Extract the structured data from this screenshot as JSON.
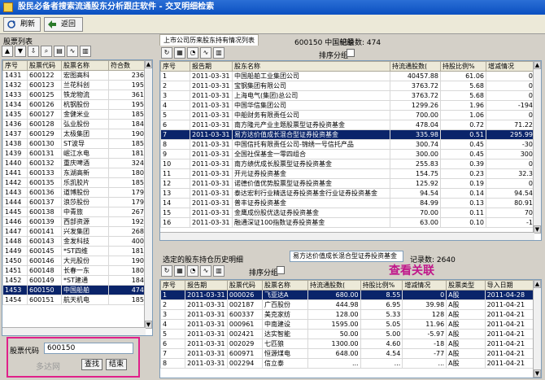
{
  "window": {
    "title": "股民必备者搜索流通股东分析跟庄软件 - 交叉明细检索"
  },
  "toolbar": {
    "refresh_label": "刷新",
    "back_label": "返回"
  },
  "left": {
    "panel_title": "股票列表",
    "columns": [
      "序号",
      "股票代码",
      "股票名称",
      "符合数"
    ],
    "rows": [
      [
        "1431",
        "600122",
        "宏图高科",
        "236"
      ],
      [
        "1432",
        "600123",
        "兰花科创",
        "195"
      ],
      [
        "1433",
        "600125",
        "铁龙物流",
        "361"
      ],
      [
        "1434",
        "600126",
        "杭钢股份",
        "195"
      ],
      [
        "1435",
        "600127",
        "金健米业",
        "185"
      ],
      [
        "1436",
        "600128",
        "弘业股份",
        "184"
      ],
      [
        "1437",
        "600129",
        "太极集团",
        "190"
      ],
      [
        "1438",
        "600130",
        "ST波导",
        "185"
      ],
      [
        "1439",
        "600131",
        "岷江水电",
        "181"
      ],
      [
        "1440",
        "600132",
        "重庆啤酒",
        "324"
      ],
      [
        "1441",
        "600133",
        "东湖高新",
        "180"
      ],
      [
        "1442",
        "600135",
        "乐凯胶片",
        "185"
      ],
      [
        "1443",
        "600136",
        "道博股份",
        "179"
      ],
      [
        "1444",
        "600137",
        "浪莎股份",
        "179"
      ],
      [
        "1445",
        "600138",
        "中青旅",
        "267"
      ],
      [
        "1446",
        "600139",
        "西部资源",
        "192"
      ],
      [
        "1447",
        "600141",
        "兴发集团",
        "268"
      ],
      [
        "1448",
        "600143",
        "金发科技",
        "400"
      ],
      [
        "1449",
        "600145",
        "*ST四维",
        "181"
      ],
      [
        "1450",
        "600146",
        "大元股份",
        "190"
      ],
      [
        "1451",
        "600148",
        "长春一东",
        "180"
      ],
      [
        "1452",
        "600149",
        "*ST建通",
        "184"
      ],
      [
        "1453",
        "600150",
        "中国船舶",
        "474"
      ],
      [
        "1454",
        "600151",
        "航天机电",
        "185"
      ]
    ],
    "selected_index": 22,
    "search": {
      "label": "股票代码",
      "value": "600150",
      "find_label": "查找",
      "close_label": "结束"
    }
  },
  "top": {
    "tab_label": "上市公司历来股东持有情况列表",
    "stock_info": "600150 中国船舶",
    "record_label": "记录数: 474",
    "sort_label": "排序分组",
    "columns": [
      "序号",
      "报告期",
      "股东名称",
      "持流通股数(",
      "持股比例%",
      "增减情况"
    ],
    "rows": [
      [
        "1",
        "2011-03-31",
        "中国船舶工业集团公司",
        "40457.88",
        "61.06",
        "0"
      ],
      [
        "2",
        "2011-03-31",
        "宝钢集团有限公司",
        "3763.72",
        "5.68",
        "0"
      ],
      [
        "3",
        "2011-03-31",
        "上海电气(集团)总公司",
        "3763.72",
        "5.68",
        "0"
      ],
      [
        "4",
        "2011-03-31",
        "中国华信集团公司",
        "1299.26",
        "1.96",
        "-194"
      ],
      [
        "5",
        "2011-03-31",
        "中船财务有限责任公司",
        "700.00",
        "1.06",
        "0"
      ],
      [
        "6",
        "2011-03-31",
        "南方隆元产业主题股票型证券投资基金",
        "478.04",
        "0.72",
        "71.22"
      ],
      [
        "7",
        "2011-03-31",
        "易方达价值成长混合型证券投资基金",
        "335.98",
        "0.51",
        "295.99"
      ],
      [
        "8",
        "2011-03-31",
        "中国信托有限责任公司-锦绣一号信托产品",
        "300.74",
        "0.45",
        "-30"
      ],
      [
        "9",
        "2011-03-31",
        "全国社保基金一零四组合",
        "300.00",
        "0.45",
        "300"
      ],
      [
        "10",
        "2011-03-31",
        "南方绩优成长股票型证券投资基金",
        "255.83",
        "0.39",
        "0"
      ],
      [
        "11",
        "2011-03-31",
        "开元证券投资基金",
        "154.75",
        "0.23",
        "32.3"
      ],
      [
        "12",
        "2011-03-31",
        "诺德价值优势股票型证券投资基金",
        "125.92",
        "0.19",
        "0"
      ],
      [
        "13",
        "2011-03-31",
        "泰达宏利行业精选证券投资基金行业证券投资基金",
        "94.54",
        "0.14",
        "94.54"
      ],
      [
        "14",
        "2011-03-31",
        "普丰证券投资基金",
        "84.99",
        "0.13",
        "80.91"
      ],
      [
        "15",
        "2011-03-31",
        "金鹰成份股优选证券投资基金",
        "70.00",
        "0.11",
        "70"
      ],
      [
        "16",
        "2011-03-31",
        "融通深证100指数证券投资基金",
        "63.00",
        "0.10",
        "-1"
      ]
    ],
    "selected_index": 6
  },
  "bottom": {
    "panel_title": "选定的股东持仓历史明细",
    "holder_name": "易方达价值成长混合型证券投资基金",
    "record_label": "记录数: 2640",
    "overlay_label": "查看关联",
    "sort_label": "排序分组",
    "columns": [
      "序号",
      "报告期",
      "股票代码",
      "股票名称",
      "持流通股数(",
      "持股比例%",
      "增减情况",
      "股票类型",
      "导入日期"
    ],
    "rows": [
      [
        "1",
        "2011-03-31",
        "000026",
        "飞亚达A",
        "680.00",
        "8.55",
        "0",
        "A股",
        "2011-04-28"
      ],
      [
        "2",
        "2011-03-31",
        "002187",
        "广百股份",
        "444.98",
        "6.95",
        "39.98",
        "A股",
        "2011-04-21"
      ],
      [
        "3",
        "2011-03-31",
        "600337",
        "美克家纺",
        "128.00",
        "5.33",
        "128",
        "A股",
        "2011-04-21"
      ],
      [
        "4",
        "2011-03-31",
        "000961",
        "中南建设",
        "1595.00",
        "5.05",
        "11.96",
        "A股",
        "2011-04-21"
      ],
      [
        "5",
        "2011-03-31",
        "002421",
        "达实智能",
        "50.00",
        "5.00",
        "-5.97",
        "A股",
        "2011-04-21"
      ],
      [
        "6",
        "2011-03-31",
        "002029",
        "七匹狼",
        "1300.00",
        "4.60",
        "-18",
        "A股",
        "2011-04-21"
      ],
      [
        "7",
        "2011-03-31",
        "600971",
        "恒源煤电",
        "648.00",
        "4.54",
        "-77",
        "A股",
        "2011-04-21"
      ],
      [
        "8",
        "2011-03-31",
        "002294",
        "信立泰",
        "...",
        "...",
        "...",
        "A股",
        "2011-04-21"
      ]
    ],
    "selected_index": 0
  },
  "watermark": "多达网"
}
